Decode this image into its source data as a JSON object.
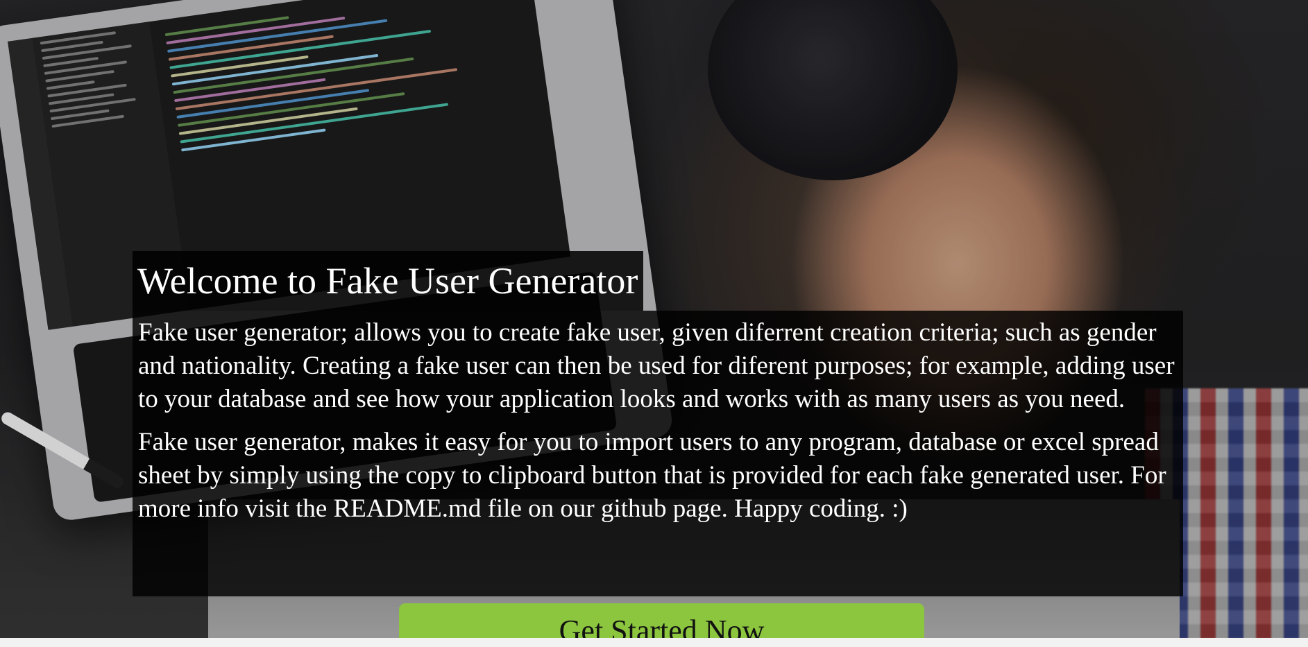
{
  "hero": {
    "background_image": "person-coding-on-laptop-photo",
    "title": "Welcome to Fake User Generator",
    "paragraphs": [
      "Fake user generator; allows you to create fake user, given diferrent creation criteria; such as gender and nationality. Creating a fake user can then be used for diferent purposes; for example, adding user to your database and see how your application looks and works with as many users as you need.",
      "Fake user generator, makes it easy for you to import users to any program, database or excel spread sheet by simply using the copy to clipboard button that is provided for each fake generated user. For more info visit the README.md file on our github page. Happy coding. :)"
    ],
    "cta_label": "Get Started Now"
  },
  "colors": {
    "cta_background": "#8cc63f",
    "text_box_background": "#000000",
    "text_color": "#ffffff",
    "page_background": "#f2f2f2"
  }
}
